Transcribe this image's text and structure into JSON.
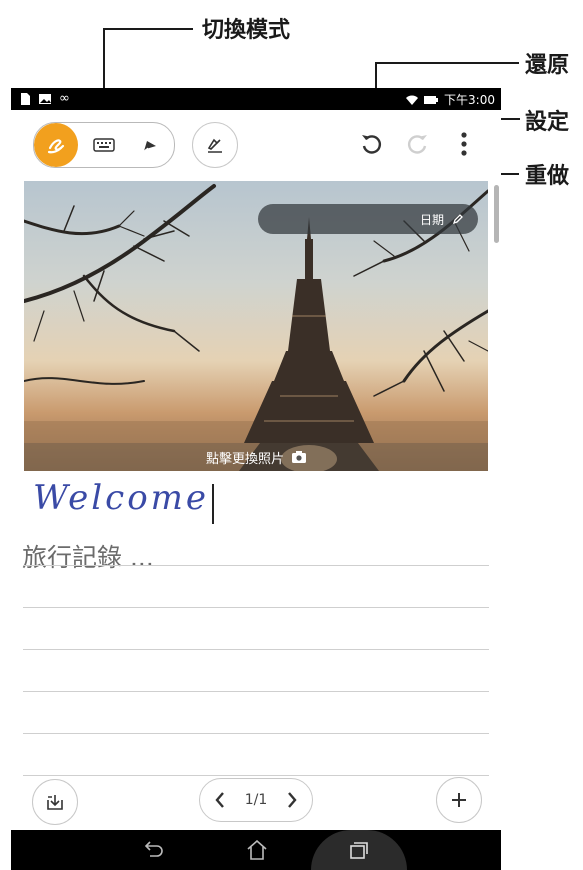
{
  "callouts": {
    "switch_mode": "切換模式",
    "undo": "還原",
    "settings": "設定",
    "redo": "重做"
  },
  "status_bar": {
    "time": "下午3:00",
    "icons": [
      "document-icon",
      "image-icon",
      "infinity-icon",
      "wifi-icon",
      "battery-icon"
    ]
  },
  "toolbar": {
    "modes": [
      {
        "name": "handwriting-mode",
        "icon": "handwriting-icon",
        "active": true
      },
      {
        "name": "keyboard-mode",
        "icon": "keyboard-icon",
        "active": false
      },
      {
        "name": "pen-mode",
        "icon": "pen-icon",
        "active": false
      }
    ],
    "colors": {
      "accent": "#f2a01e"
    }
  },
  "photo": {
    "date_label": "日期",
    "change_photo_label": "點擊更換照片"
  },
  "note": {
    "handwriting": "Welcome",
    "title": "旅行記錄 ..."
  },
  "pager": {
    "current": "1/1"
  }
}
